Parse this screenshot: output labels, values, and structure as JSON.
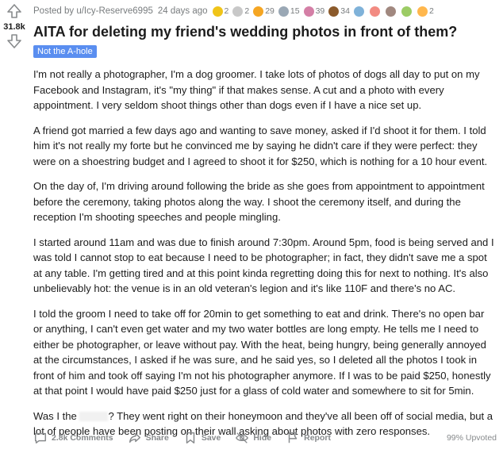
{
  "post": {
    "score": "31.8k",
    "posted_by": "Posted by u/Icy-Reserve6995",
    "time": "24 days ago",
    "awards": [
      {
        "icon": "gold-award-icon",
        "color": "#f0c419",
        "count": "2"
      },
      {
        "icon": "silver-award-icon",
        "color": "#c8c8c8",
        "count": "2"
      },
      {
        "icon": "wholesome-award-icon",
        "color": "#f5a623",
        "count": "29"
      },
      {
        "icon": "helpful-award-icon",
        "color": "#9aa8b5",
        "count": "15"
      },
      {
        "icon": "brain-award-icon",
        "color": "#d47fa6",
        "count": "39"
      },
      {
        "icon": "poop-award-icon",
        "color": "#8b5a2b",
        "count": "34"
      },
      {
        "icon": "misc-award-icon-1",
        "color": "#7fb2d9",
        "count": ""
      },
      {
        "icon": "misc-award-icon-2",
        "color": "#f28b82",
        "count": ""
      },
      {
        "icon": "misc-award-icon-3",
        "color": "#a1887f",
        "count": ""
      },
      {
        "icon": "misc-award-icon-4",
        "color": "#9ccc65",
        "count": ""
      },
      {
        "icon": "misc-award-icon-5",
        "color": "#ffb74d",
        "count": "2"
      }
    ],
    "title": "AITA for deleting my friend's wedding photos in front of them?",
    "flair": "Not the A-hole",
    "flair_color": "#5a8ef0",
    "paragraphs": [
      "I'm not really a photographer, I'm a dog groomer. I take lots of photos of dogs all day to put on my Facebook and Instagram, it's \"my thing\" if that makes sense. A cut and a photo with every appointment. I very seldom shoot things other than dogs even if I have a nice set up.",
      "A friend got married a few days ago and wanting to save money, asked if I'd shoot it for them. I told him it's not really my forte but he convinced me by saying he didn't care if they were perfect: they were on a shoestring budget and I agreed to shoot it for $250, which is nothing for a 10 hour event.",
      "On the day of, I'm driving around following the bride as she goes from appointment to appointment before the ceremony, taking photos along the way. I shoot the ceremony itself, and during the reception I'm shooting speeches and people mingling.",
      "I started around 11am and was due to finish around 7:30pm. Around 5pm, food is being served and I was told I cannot stop to eat because I need to be photographer; in fact, they didn't save me a spot at any table. I'm getting tired and at this point kinda regretting doing this for next to nothing. It's also unbelievably hot: the venue is in an old veteran's legion and it's like 110F and there's no AC.",
      "I told the groom I need to take off for 20min to get something to eat and drink. There's no open bar or anything, I can't even get water and my two water bottles are long empty. He tells me I need to either be photographer, or leave without pay. With the heat, being hungry, being generally annoyed at the circumstances, I asked if he was sure, and he said yes, so I deleted all the photos I took in front of him and took off saying I'm not his photographer anymore. If I was to be paid $250, honestly at that point I would have paid $250 just for a glass of cold water and somewhere to sit for 5min."
    ],
    "last_para_start": "Was I the",
    "last_para_end": "? They went right on their honeymoon and they've all been off of social media, but a lot of people have been posting on their wall asking about photos with zero responses.",
    "actions": {
      "comments": "2.8k Comments",
      "share": "Share",
      "save": "Save",
      "hide": "Hide",
      "report": "Report"
    },
    "upvoted": "99% Upvoted"
  }
}
